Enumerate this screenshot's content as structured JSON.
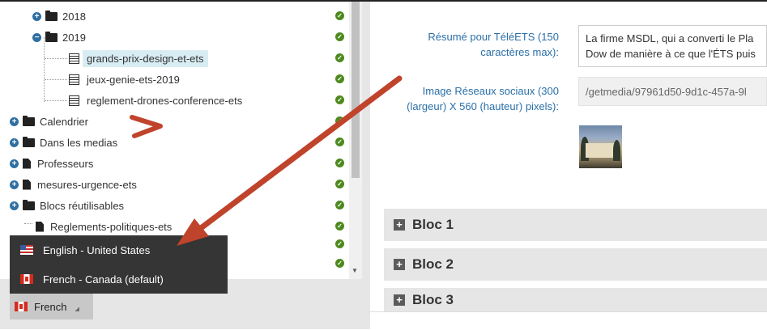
{
  "tree": {
    "items": [
      {
        "label": "2018",
        "type": "folder",
        "expander": "+"
      },
      {
        "label": "2019",
        "type": "folder",
        "expander": "−"
      },
      {
        "label": "grands-prix-design-et-ets",
        "type": "doc"
      },
      {
        "label": "jeux-genie-ets-2019",
        "type": "doc"
      },
      {
        "label": "reglement-drones-conference-ets",
        "type": "doc"
      },
      {
        "label": "Calendrier",
        "type": "folder",
        "expander": "+"
      },
      {
        "label": "Dans les medias",
        "type": "folder",
        "expander": "+"
      },
      {
        "label": "Professeurs",
        "type": "page",
        "expander": "+"
      },
      {
        "label": "mesures-urgence-ets",
        "type": "page",
        "expander": "+"
      },
      {
        "label": "Blocs réutilisables",
        "type": "folder",
        "expander": "+"
      },
      {
        "label": "Reglements-politiques-ets",
        "type": "page"
      }
    ],
    "status_icon": "check-circle-icon"
  },
  "culture_selector": {
    "current": "French",
    "options": [
      {
        "label": "English - United States",
        "flag": "us-flag-icon"
      },
      {
        "label": "French - Canada (default)",
        "flag": "canada-flag-icon"
      }
    ]
  },
  "form": {
    "summary_label": "Résumé pour TéléETS (150 caractères max):",
    "summary_value_line1": "La firme MSDL, qui a converti le Pla",
    "summary_value_line2": "Dow de manière à ce que l'ÉTS puis",
    "social_image_label": "Image Réseaux sociaux (300 (largeur) X 560 (hauteur) pixels):",
    "social_image_value": "/getmedia/97961d50-9d1c-457a-9l"
  },
  "blocs": [
    "Bloc 1",
    "Bloc 2",
    "Bloc 3"
  ],
  "colors": {
    "accent_blue": "#2a6fa8",
    "check_green": "#4d8a1e",
    "annotation_arrow": "#c0432b",
    "dropdown_bg": "#353535",
    "selected_bg": "#d8ecf3"
  }
}
